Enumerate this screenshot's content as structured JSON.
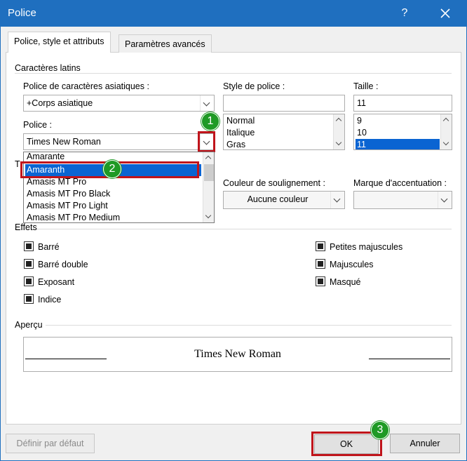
{
  "window": {
    "title": "Police",
    "help_glyph": "?",
    "close_icon": "close-icon"
  },
  "tabs": [
    {
      "label": "Police, style et attributs",
      "active": true
    },
    {
      "label": "Paramètres avancés",
      "active": false
    }
  ],
  "latin": {
    "group_label": "Caractères latins"
  },
  "asian_font": {
    "label": "Police de caractères asiatiques :",
    "value": "+Corps asiatique"
  },
  "font": {
    "label": "Police  :",
    "value": "Times New Roman",
    "dropdown_items": [
      "Amarante",
      "Amaranth",
      "Amasis MT Pro",
      "Amasis MT Pro Black",
      "Amasis MT Pro Light",
      "Amasis MT Pro Medium"
    ],
    "selected_item": "Amaranth"
  },
  "style": {
    "label": "Style de police :",
    "value": "",
    "items": [
      "Normal",
      "Italique",
      "Gras"
    ]
  },
  "size": {
    "label": "Taille :",
    "value": "11",
    "items": [
      "9",
      "10",
      "11"
    ],
    "selected_item": "11"
  },
  "underline_color": {
    "label": "Couleur de soulignement :",
    "value": "Aucune couleur"
  },
  "emphasis": {
    "label": "Marque d'accentuation :",
    "value": ""
  },
  "obscured_group_letter": "T",
  "effects": {
    "group_label": "Effets",
    "left": [
      "Barré",
      "Barré double",
      "Exposant",
      "Indice"
    ],
    "right": [
      "Petites majuscules",
      "Majuscules",
      "Masqué"
    ]
  },
  "preview": {
    "group_label": "Aperçu",
    "text": "Times New Roman"
  },
  "buttons": {
    "default": "Définir par défaut",
    "ok": "OK",
    "cancel": "Annuler"
  },
  "badges": [
    "1",
    "2",
    "3"
  ],
  "colors": {
    "title_bar": "#1f6fbf",
    "selection": "#0a64d2",
    "highlight_frame": "#c0141b",
    "badge": "#1f9a25"
  }
}
